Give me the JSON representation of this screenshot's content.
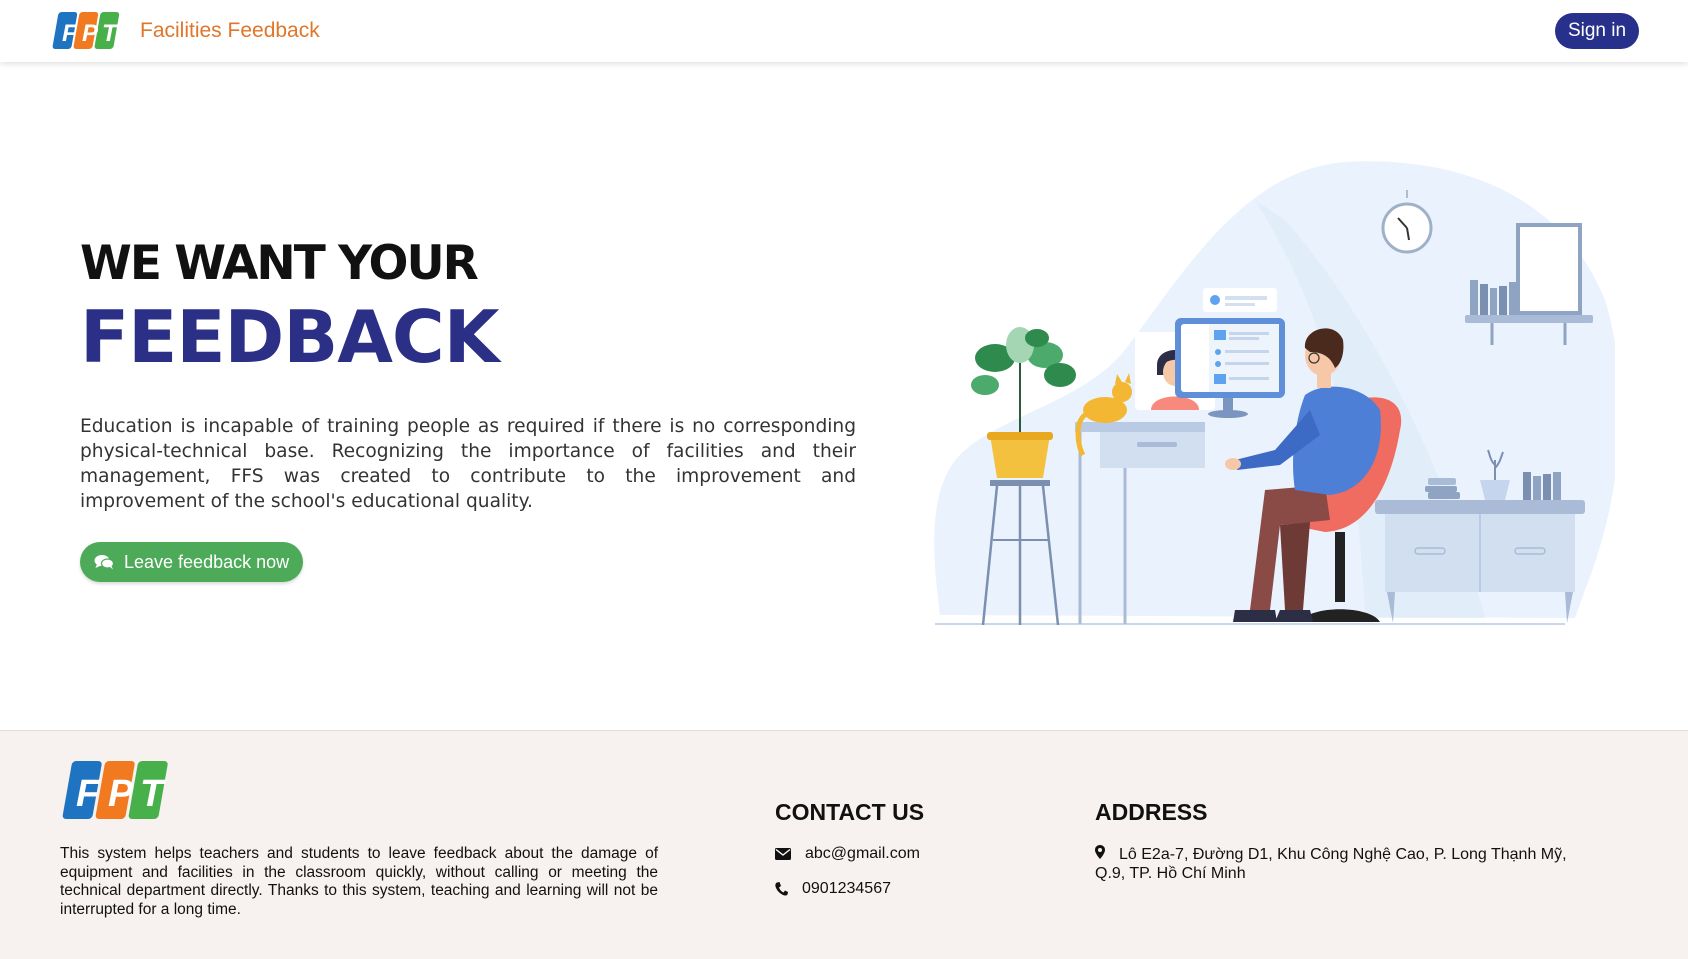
{
  "header": {
    "brand_name": "Facilities Feedback",
    "signin_label": "Sign in"
  },
  "logo": {
    "letters": [
      "F",
      "P",
      "T"
    ],
    "colors": [
      "#1e74c0",
      "#f17a21",
      "#48b04a"
    ]
  },
  "hero": {
    "title_line1": "WE WANT YOUR",
    "title_line2": "FEEDBACK",
    "description": "Education is incapable of training people as required if there is no corresponding physical-technical base. Recognizing the importance of facilities and their management, FFS was created to contribute to the improvement and improvement of the school's educational quality.",
    "cta_label": "Leave feedback now",
    "cta_icon": "comments-icon"
  },
  "footer": {
    "description": "This system helps teachers and students to leave feedback about the damage of equipment and facilities in the classroom quickly, without calling or meeting the technical department directly. Thanks to this system, teaching and learning will not be interrupted for a long time.",
    "contact_heading": "CONTACT US",
    "email": "abc@gmail.com",
    "phone": "0901234567",
    "address_heading": "ADDRESS",
    "address": "Lô E2a-7, Đường D1, Khu Công Nghệ Cao, P. Long Thạnh Mỹ, Q.9, TP. Hồ Chí Minh"
  },
  "colors": {
    "primary": "#27308a",
    "feedback_title": "#2c2f86",
    "brand_orange": "#e1762a",
    "cta_green": "#4caa58",
    "footer_bg": "#f7f1f0"
  }
}
